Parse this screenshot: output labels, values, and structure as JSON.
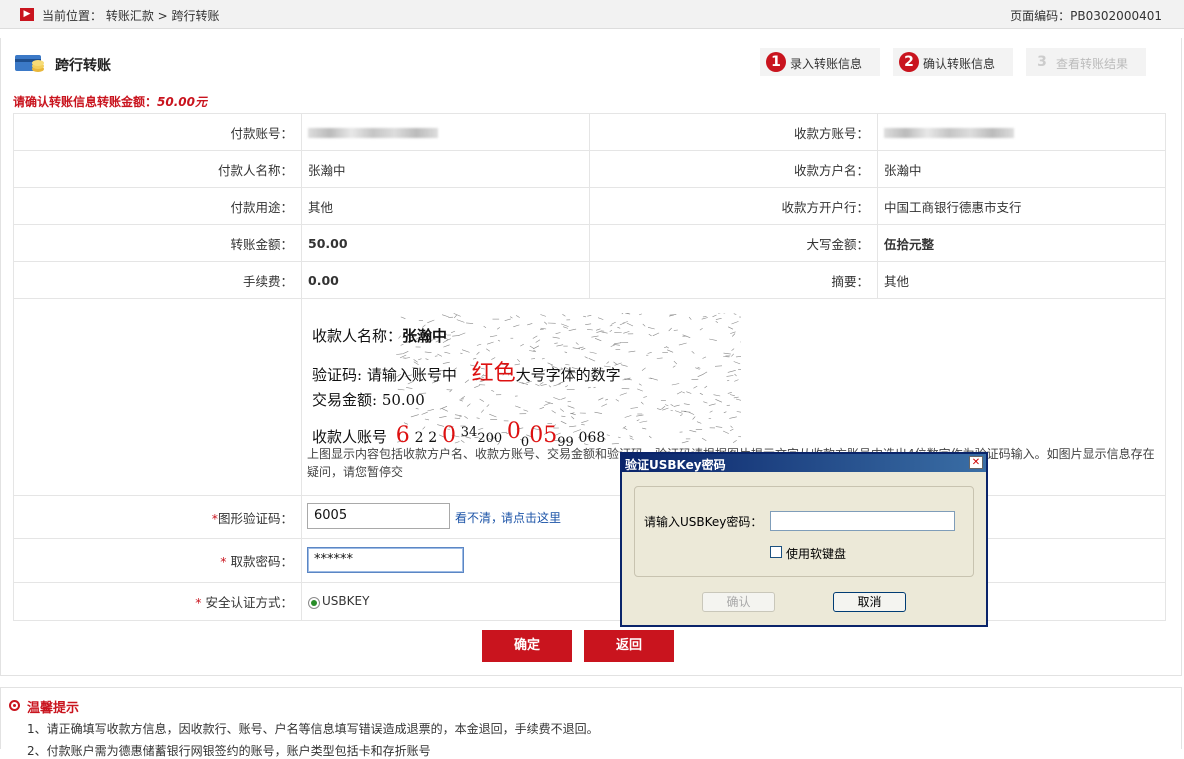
{
  "breadcrumb": {
    "prefix": "当前位置：",
    "path": "转账汇款 > 跨行转账"
  },
  "page_code": "页面编码：PB0302000401",
  "page_title": "跨行转账",
  "steps": [
    {
      "num": "1",
      "label": "录入转账信息"
    },
    {
      "num": "2",
      "label": "确认转账信息"
    },
    {
      "num": "3",
      "label": "查看转账结果"
    }
  ],
  "confirm": {
    "text": "请确认转账信息转账金额：",
    "amount": "50.00元"
  },
  "rows": [
    {
      "l1": "付款账号：",
      "v1": "",
      "l2": "收款方账号：",
      "v2": ""
    },
    {
      "l1": "付款人名称：",
      "v1": "张瀚中",
      "l2": "收款方户名：",
      "v2": "张瀚中"
    },
    {
      "l1": "付款用途：",
      "v1": "其他",
      "l2": "收款方开户行：",
      "v2": "中国工商银行德惠市支行"
    },
    {
      "l1": "转账金额：",
      "v1": "50.00",
      "l2": "大写金额：",
      "v2": "伍拾元整"
    },
    {
      "l1": "手续费：",
      "v1": "0.00",
      "l2": "摘要：",
      "v2": "其他"
    }
  ],
  "captcha": {
    "line1_label": "收款人名称：",
    "line1_value": "张瀚中",
    "line2_a": "验证码: 请输入账号中",
    "line2_red": "红色",
    "line2_b": "大号字体的数字",
    "line3": "交易金额: 50.00",
    "line4_label": "收款人账号",
    "digits": [
      "6",
      "2",
      "2",
      "0",
      "34",
      "200",
      "0",
      "0",
      "05",
      "99",
      "068"
    ]
  },
  "captcha_desc": "上图显示内容包括收款方户名、收款方账号、交易金额和验证码。验证码请根据图片提示文字从收款方账号中选出4位数字作为验证码输入。如图片显示信息存在疑问，请您暂停交",
  "form": {
    "captcha_label": "图形验证码：",
    "captcha_value": "6005",
    "refresh_a": "看不清，",
    "refresh_b": "请点击这里",
    "password_label": "取款密码：",
    "password_value": "******",
    "auth_label": "安全认证方式：",
    "auth_value": "USBKEY"
  },
  "buttons": {
    "ok": "确定",
    "back": "返回"
  },
  "tips": {
    "title": "温馨提示",
    "line1": "1、请正确填写收款方信息，因收款行、账号、户名等信息填写错误造成退票的，本金退回，手续费不退回。",
    "line2": "2、付款账户需为德惠储蓄银行网银签约的账号，账户类型包括卡和存折账号"
  },
  "dialog": {
    "title": "验证USBKey密码",
    "label": "请输入USBKey密码：",
    "checkbox": "使用软键盘",
    "ok": "确认",
    "cancel": "取消"
  },
  "colors": {
    "brand_red": "#c9141e",
    "link_blue": "#1e55a8",
    "dialog_title": "#0a246a"
  }
}
